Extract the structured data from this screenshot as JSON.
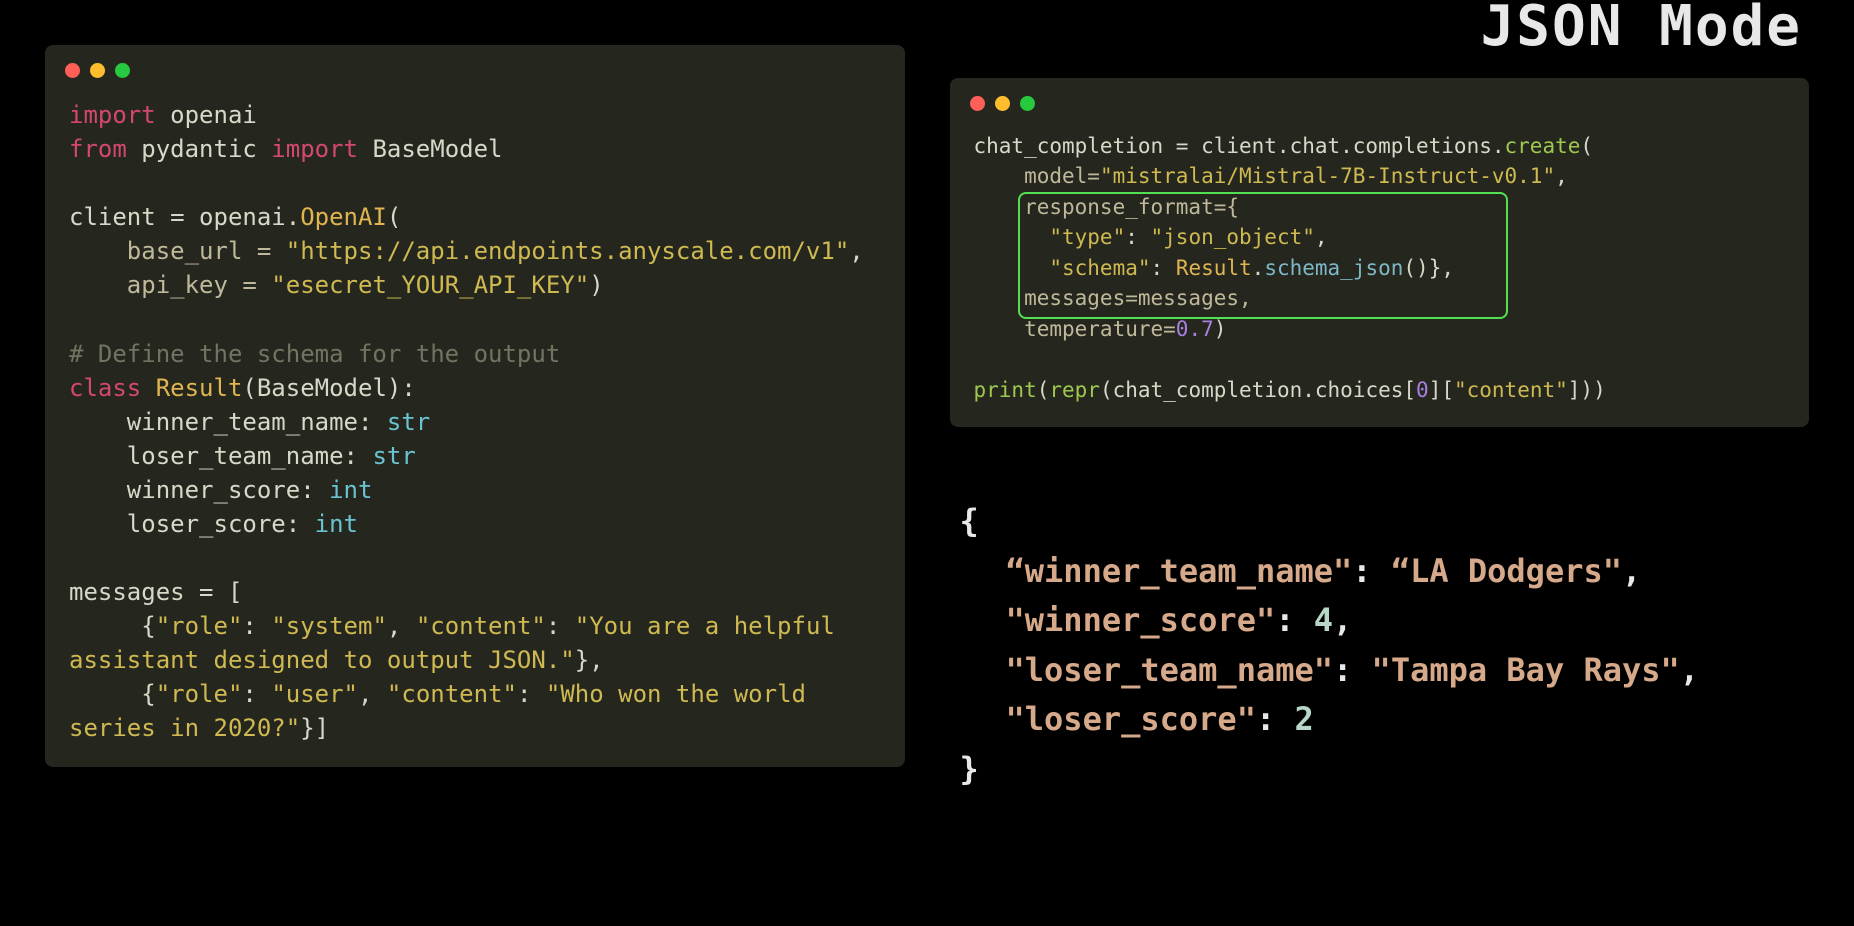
{
  "title": "JSON Mode",
  "left_code": {
    "import_kw1": "import",
    "import_mod1": "openai",
    "from_kw": "from",
    "from_mod": "pydantic",
    "import_kw2": "import",
    "basemodel": "BaseModel",
    "client_assign": "client = openai.",
    "openai_cls": "OpenAI",
    "openai_paren": "(",
    "base_url_param": "    base_url = ",
    "base_url_val": "\"https://api.endpoints.anyscale.com/v1\"",
    "api_key_param": "    api_key = ",
    "api_key_val": "\"esecret_YOUR_API_KEY\"",
    "close1": ")",
    "comment": "# Define the schema for the output",
    "class_kw": "class",
    "result_cls": "Result",
    "basemodel_ext": "(BaseModel):",
    "field1_name": "    winner_team_name: ",
    "field1_type": "str",
    "field2_name": "    loser_team_name: ",
    "field2_type": "str",
    "field3_name": "    winner_score: ",
    "field3_type": "int",
    "field4_name": "    loser_score: ",
    "field4_type": "int",
    "messages_assign": "messages = [",
    "msg1_open": "     {",
    "role_key1": "\"role\"",
    "role_val1": "\"system\"",
    "content_key1": "\"content\"",
    "content_val1a": "\"You are a helpful ",
    "content_val1b": "assistant designed to output JSON.\"",
    "msg1_close": "},",
    "msg2_open": "     {",
    "role_key2": "\"role\"",
    "role_val2": "\"user\"",
    "content_key2": "\"content\"",
    "content_val2a": "\"Who won the world ",
    "content_val2b": "series in 2020?\"",
    "msg2_close": "}]"
  },
  "right_code": {
    "line1a": "chat_completion = client.chat.completions.",
    "create_fn": "create",
    "line1b": "(",
    "model_param": "    model=",
    "model_val": "\"mistralai/Mistral-7B-Instruct-v0.1\"",
    "model_comma": ",",
    "rf_param": "    response_format={",
    "type_key": "      \"type\"",
    "type_val": "\"json_object\"",
    "schema_key": "      \"schema\"",
    "schema_cls": "Result",
    "schema_method": "schema_json",
    "schema_suffix": "()},",
    "messages_param": "    messages=messages,",
    "temp_param": "    temperature=",
    "temp_val": "0.7",
    "temp_close": ")",
    "print_fn": "print",
    "repr_fn": "repr",
    "print_line_a": "(",
    "print_line_b": "(chat_completion.choices[",
    "idx0": "0",
    "print_line_c": "][",
    "content_key": "\"content\"",
    "print_line_d": "]))"
  },
  "output": {
    "open": "{",
    "k1": "“winner_team_name\"",
    "v1": "“LA Dodgers\"",
    "k2": "\"winner_score\"",
    "v2": "4",
    "k3": "\"loser_team_name\"",
    "v3": "\"Tampa Bay Rays\"",
    "k4": "\"loser_score\"",
    "v4": "2",
    "close": "}"
  }
}
